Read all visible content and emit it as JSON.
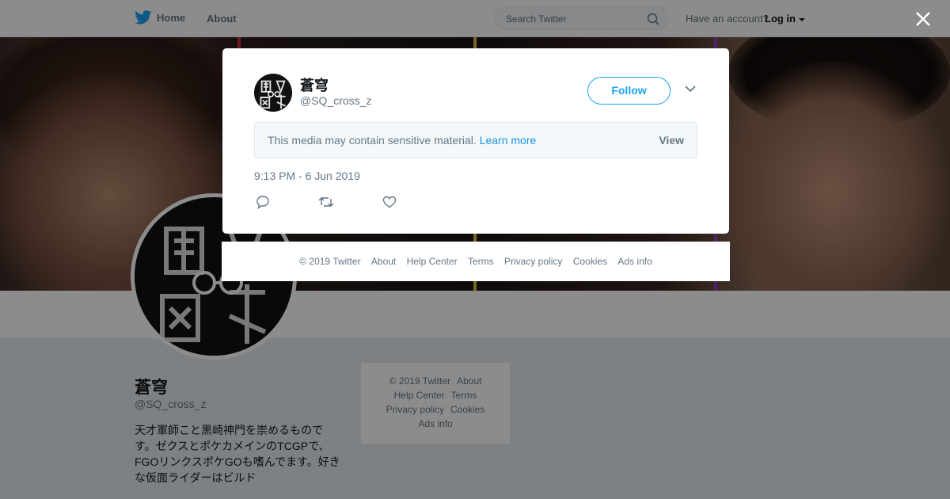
{
  "topnav": {
    "home_label": "Home",
    "about_label": "About",
    "search_placeholder": "Search Twitter",
    "have_account": "Have an account?",
    "login_label": "Log in"
  },
  "profile": {
    "name": "蒼穹",
    "handle": "@SQ_cross_z",
    "bio": "天才軍師こと黒崎神門を崇めるものです。ゼクスとポケカメインのTCGPで、FGOリンクスポケGOも嗜んでます。好きな仮面ライダーはビルド"
  },
  "side_footer": {
    "copyright": "© 2019 Twitter",
    "about": "About",
    "help_center": "Help Center",
    "terms": "Terms",
    "privacy": "Privacy policy",
    "cookies": "Cookies",
    "ads_info": "Ads info"
  },
  "modal": {
    "name": "蒼穹",
    "handle": "@SQ_cross_z",
    "follow_label": "Follow",
    "sensitive_message": "This media may contain sensitive material.",
    "learn_more": "Learn more",
    "view_label": "View",
    "timestamp": "9:13 PM - 6 Jun 2019"
  },
  "footer": {
    "copyright": "© 2019 Twitter",
    "about": "About",
    "help_center": "Help Center",
    "terms": "Terms",
    "privacy": "Privacy policy",
    "cookies": "Cookies",
    "ads_info": "Ads info"
  },
  "colors": {
    "twitter_blue": "#1da1f2",
    "link_blue": "#1b95e0",
    "overlay": "rgba(0,0,0,0.45)"
  },
  "icons": [
    "twitter-bird-icon",
    "search-icon",
    "caret-down-icon",
    "close-icon",
    "chevron-down-icon",
    "reply-icon",
    "retweet-icon",
    "like-icon"
  ]
}
